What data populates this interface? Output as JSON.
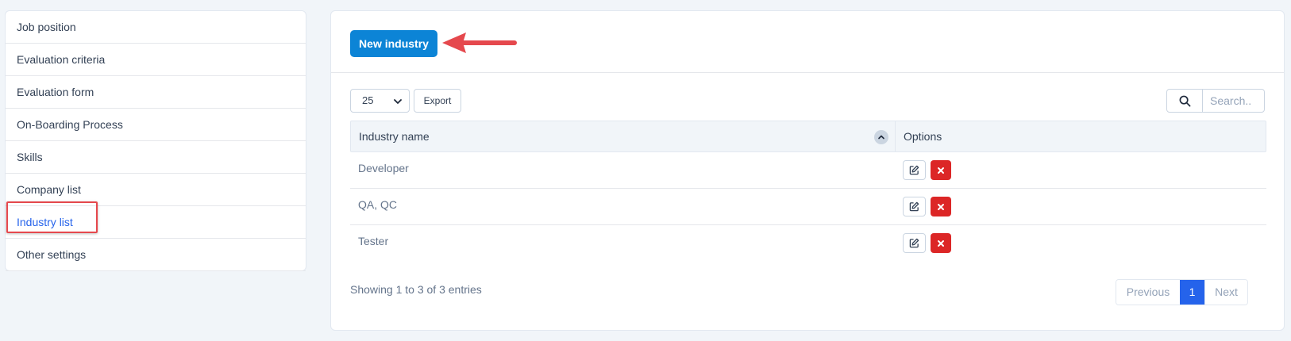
{
  "sidebar": {
    "items": [
      {
        "label": "Job position"
      },
      {
        "label": "Evaluation criteria"
      },
      {
        "label": "Evaluation form"
      },
      {
        "label": "On-Boarding Process"
      },
      {
        "label": "Skills"
      },
      {
        "label": "Company list"
      },
      {
        "label": "Industry list",
        "active": true
      },
      {
        "label": "Other settings"
      }
    ]
  },
  "header": {
    "new_button_label": "New industry"
  },
  "controls": {
    "page_length": "25",
    "export_label": "Export",
    "search_placeholder": "Search.."
  },
  "table": {
    "columns": [
      "Industry name",
      "Options"
    ],
    "rows": [
      {
        "name": "Developer"
      },
      {
        "name": "QA, QC"
      },
      {
        "name": "Tester"
      }
    ]
  },
  "footer": {
    "info": "Showing 1 to 3 of 3 entries",
    "pagination": {
      "previous": "Previous",
      "current": "1",
      "next": "Next"
    }
  },
  "colors": {
    "primary": "#0c84d6",
    "active_link": "#2563eb",
    "danger": "#dc2626",
    "annotation": "#e5484d"
  },
  "icons": {
    "search": "search-icon",
    "edit": "edit-icon",
    "delete": "close-icon",
    "sort": "chevron-up-icon",
    "dropdown": "chevron-down-icon"
  }
}
